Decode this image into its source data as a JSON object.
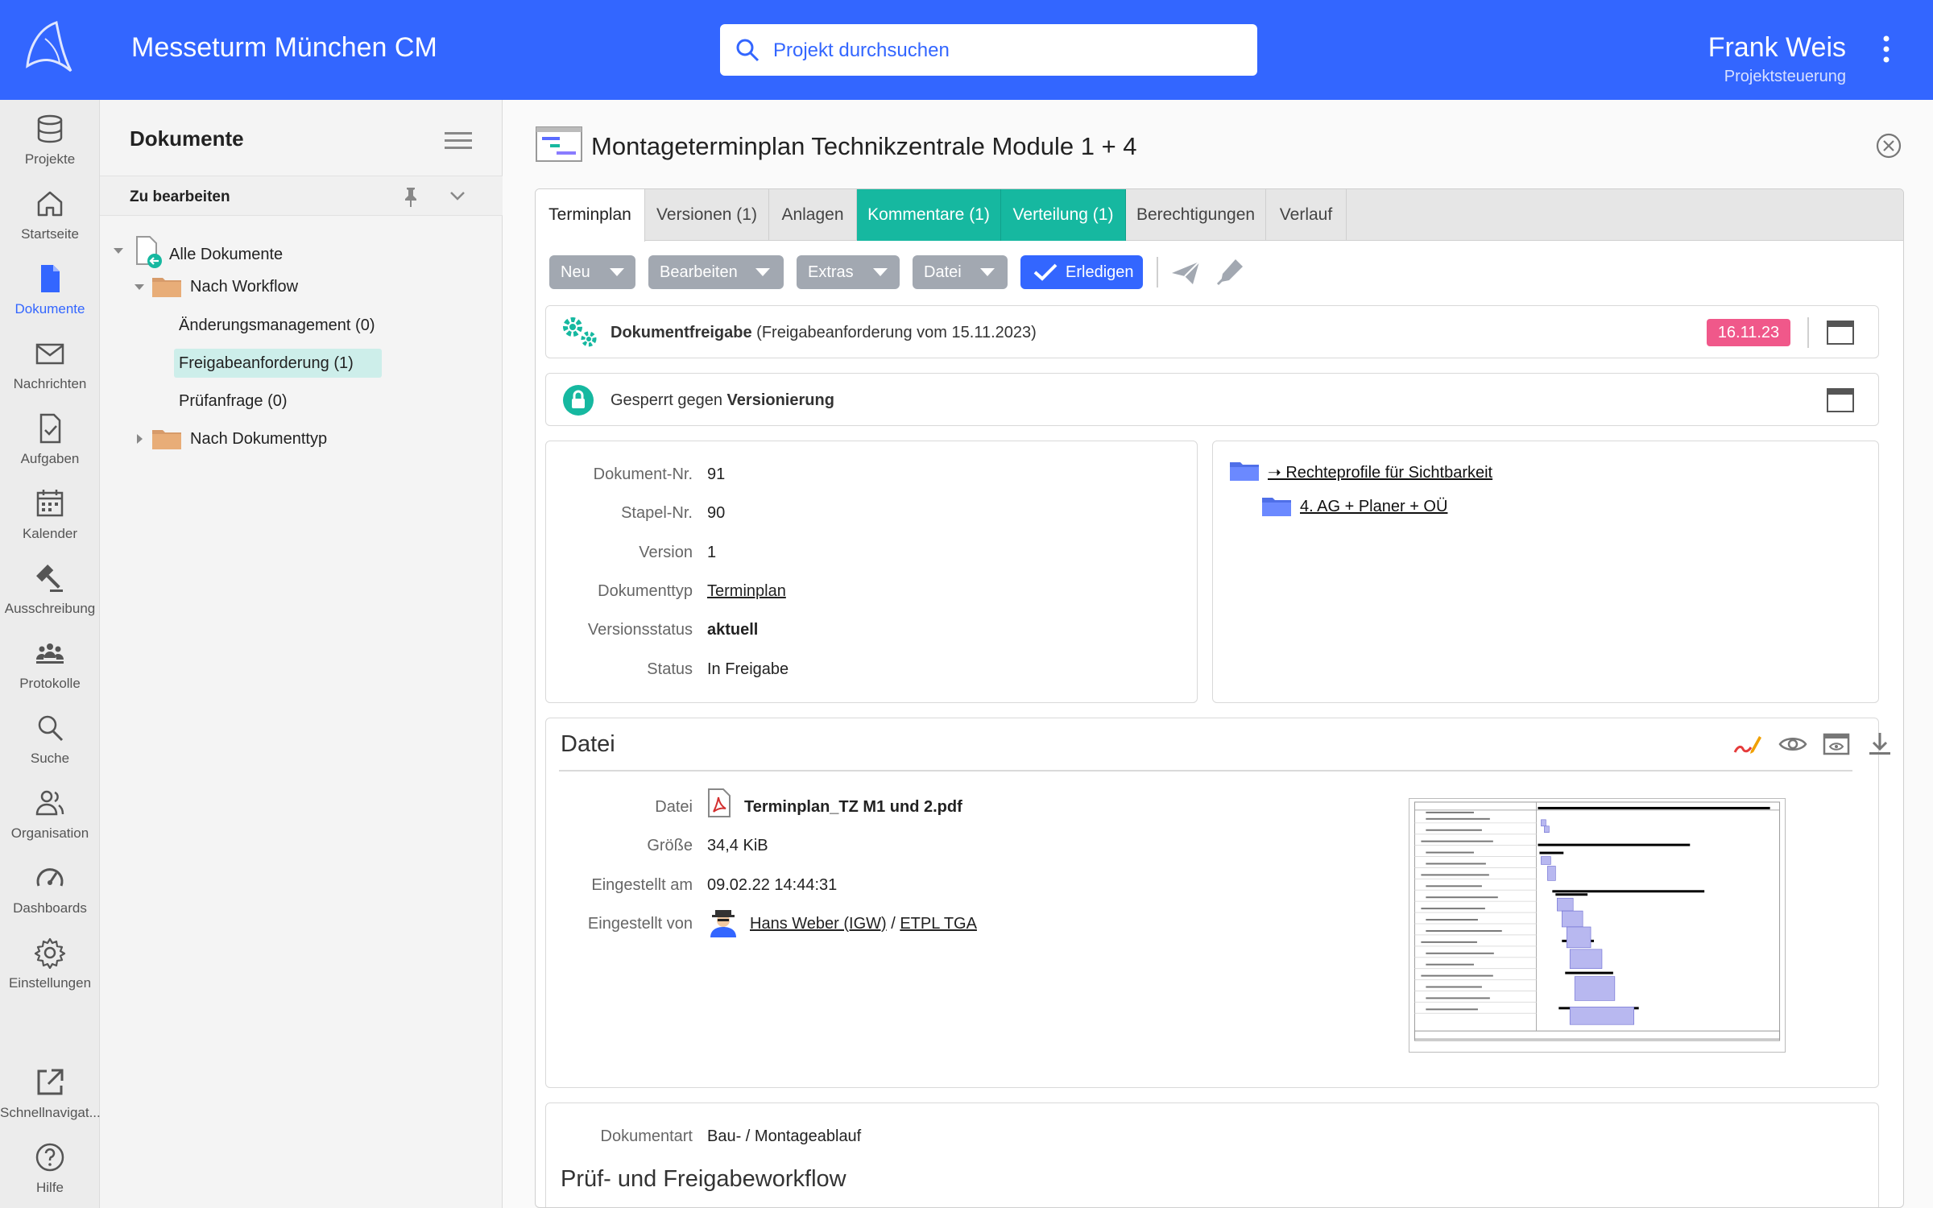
{
  "header": {
    "app_title": "Messeturm München CM",
    "search_placeholder": "Projekt durchsuchen",
    "user_name": "Frank Weis",
    "user_role": "Projektsteuerung",
    "accent_color": "#3366ff"
  },
  "rail": {
    "items": [
      {
        "label": "Projekte",
        "icon": "database-icon"
      },
      {
        "label": "Startseite",
        "icon": "home-icon"
      },
      {
        "label": "Dokumente",
        "icon": "document-icon",
        "active": true
      },
      {
        "label": "Nachrichten",
        "icon": "mail-icon"
      },
      {
        "label": "Aufgaben",
        "icon": "task-icon"
      },
      {
        "label": "Kalender",
        "icon": "calendar-icon"
      },
      {
        "label": "Ausschreibung",
        "icon": "gavel-icon"
      },
      {
        "label": "Protokolle",
        "icon": "people-icon"
      },
      {
        "label": "Suche",
        "icon": "search-icon"
      },
      {
        "label": "Organisation",
        "icon": "organisation-icon"
      },
      {
        "label": "Dashboards",
        "icon": "gauge-icon"
      },
      {
        "label": "Einstellungen",
        "icon": "gear-icon"
      },
      {
        "label": "Schnellnavigat...",
        "icon": "external-link-icon"
      },
      {
        "label": "Hilfe",
        "icon": "help-icon"
      }
    ]
  },
  "tree": {
    "title": "Dokumente",
    "section": "Zu bearbeiten",
    "items": [
      {
        "label": "Alle Dokumente"
      },
      {
        "label": "Nach Workflow"
      },
      {
        "label": "Änderungsmanagement (0)"
      },
      {
        "label": "Freigabeanforderung (1)",
        "selected": true
      },
      {
        "label": "Prüfanfrage (0)"
      },
      {
        "label": "Nach Dokumenttyp"
      }
    ]
  },
  "document": {
    "title": "Montageterminplan Technikzentrale Module 1 + 4",
    "tabs": [
      {
        "label": "Terminplan",
        "state": "active"
      },
      {
        "label": "Versionen (1)"
      },
      {
        "label": "Anlagen"
      },
      {
        "label": "Kommentare (1)",
        "state": "highlight"
      },
      {
        "label": "Verteilung (1)",
        "state": "highlight"
      },
      {
        "label": "Berechtigungen"
      },
      {
        "label": "Verlauf"
      }
    ],
    "toolbar": {
      "buttons": [
        "Neu",
        "Bearbeiten",
        "Extras",
        "Datei"
      ],
      "primary": "Erledigen"
    },
    "workflow": {
      "name": "Dokumentfreigabe",
      "detail": "(Freigabeanforderung vom 15.11.2023)",
      "date": "16.11.23",
      "badge_color": "#f0588a"
    },
    "lock": {
      "prefix": "Gesperrt gegen",
      "target": "Versionierung"
    },
    "properties": [
      {
        "label": "Dokument-Nr.",
        "value": "91"
      },
      {
        "label": "Stapel-Nr.",
        "value": "90"
      },
      {
        "label": "Version",
        "value": "1"
      },
      {
        "label": "Dokumenttyp",
        "value": "Terminplan"
      },
      {
        "label": "Versionsstatus",
        "value": "aktuell"
      },
      {
        "label": "Status",
        "value": "In Freigabe"
      }
    ],
    "rights": {
      "root": "➝ Rechteprofile für Sichtbarkeit",
      "child": "4. AG + Planer + OÜ"
    },
    "file": {
      "section_title": "Datei",
      "labels": [
        "Datei",
        "Größe",
        "Eingestellt am",
        "Eingestellt von"
      ],
      "name": "Terminplan_TZ M1 und 2.pdf",
      "size": "34,4 KiB",
      "uploaded_at": "09.02.22 14:44:31",
      "uploaded_by_name": "Hans Weber (IGW)",
      "uploaded_by_sep": " / ",
      "uploaded_by_org": "ETPL TGA"
    },
    "meta": {
      "label": "Dokumentart",
      "value": "Bau- / Montageablauf",
      "next_section": "Prüf- und Freigabeworkflow"
    }
  }
}
